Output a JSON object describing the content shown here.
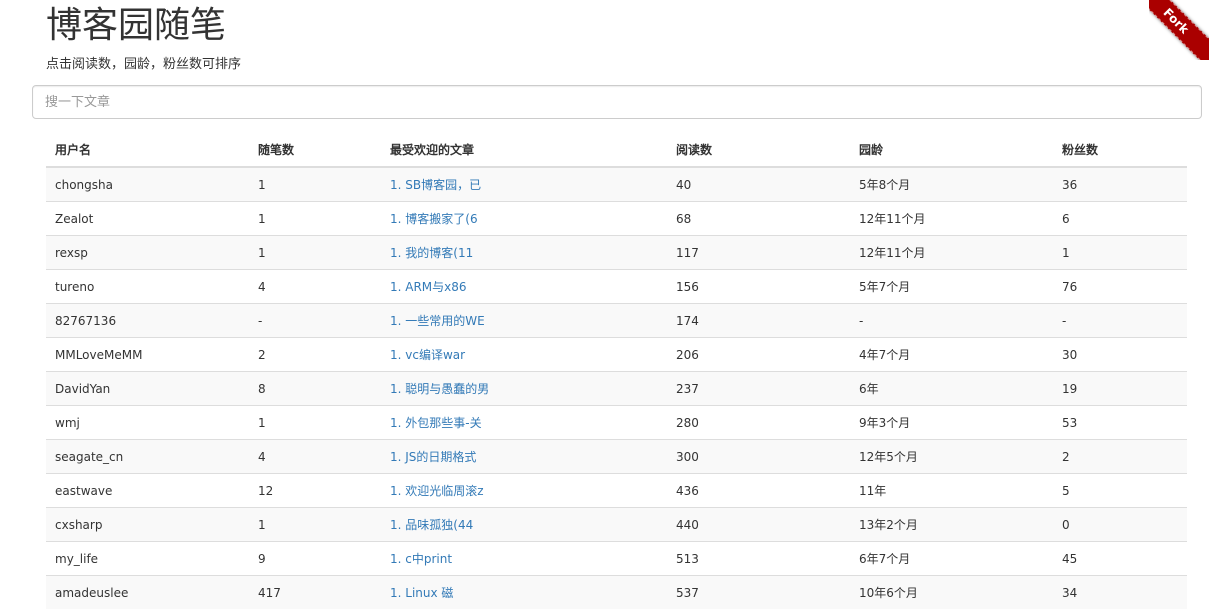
{
  "header": {
    "title": "博客园随笔",
    "subtitle": "点击阅读数，园龄，粉丝数可排序"
  },
  "search": {
    "placeholder": "搜一下文章",
    "value": ""
  },
  "ribbon": {
    "label": "Fork"
  },
  "table": {
    "columns": [
      "用户名",
      "随笔数",
      "最受欢迎的文章",
      "阅读数",
      "园龄",
      "粉丝数"
    ],
    "rows": [
      [
        "chongsha",
        "1",
        "1. SB博客园，已",
        "40",
        "5年8个月",
        "36"
      ],
      [
        "Zealot",
        "1",
        "1. 博客搬家了(6",
        "68",
        "12年11个月",
        "6"
      ],
      [
        "rexsp",
        "1",
        "1. 我的博客(11",
        "117",
        "12年11个月",
        "1"
      ],
      [
        "tureno",
        "4",
        "1. ARM与x86",
        "156",
        "5年7个月",
        "76"
      ],
      [
        "82767136",
        "-",
        "1. 一些常用的WE",
        "174",
        "-",
        "-"
      ],
      [
        "MMLoveMeMM",
        "2",
        "1. vc编译war",
        "206",
        "4年7个月",
        "30"
      ],
      [
        "DavidYan",
        "8",
        "1. 聪明与愚蠢的男",
        "237",
        "6年",
        "19"
      ],
      [
        "wmj",
        "1",
        "1. 外包那些事-关",
        "280",
        "9年3个月",
        "53"
      ],
      [
        "seagate_cn",
        "4",
        "1. JS的日期格式",
        "300",
        "12年5个月",
        "2"
      ],
      [
        "eastwave",
        "12",
        "1. 欢迎光临周滚z",
        "436",
        "11年",
        "5"
      ],
      [
        "cxsharp",
        "1",
        "1. 品味孤独(44",
        "440",
        "13年2个月",
        "0"
      ],
      [
        "my_life",
        "9",
        "1. c中print",
        "513",
        "6年7个月",
        "45"
      ],
      [
        "amadeuslee",
        "417",
        "1. Linux 磁",
        "537",
        "10年6个月",
        "34"
      ]
    ]
  },
  "colors": {
    "link": "#337ab7",
    "ribbon": "#aa0000",
    "stripe": "#f9f9f9",
    "border": "#dddddd"
  }
}
